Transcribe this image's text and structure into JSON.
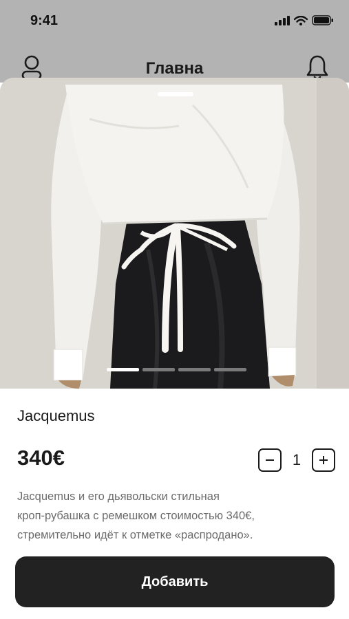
{
  "status_bar": {
    "time": "9:41"
  },
  "header": {
    "title": "Главна"
  },
  "product": {
    "brand": "Jacquemus",
    "price": "340€",
    "quantity": "1",
    "description_lines": [
      "Jacquemus и его дьявольски стильная",
      "кроп-рубашка с ремешком стоимостью 340€,",
      "стремительно идёт к отметке «распродано»."
    ],
    "image_count": 4,
    "active_image_index": 0
  },
  "actions": {
    "add_label": "Добавить"
  },
  "colors": {
    "accent": "#222222",
    "header_bg": "#b3b3b3",
    "description": "#6b6b6b"
  },
  "icons": {
    "profile": "user-icon",
    "notifications": "bell-icon",
    "minus": "minus-icon",
    "plus": "plus-icon"
  }
}
